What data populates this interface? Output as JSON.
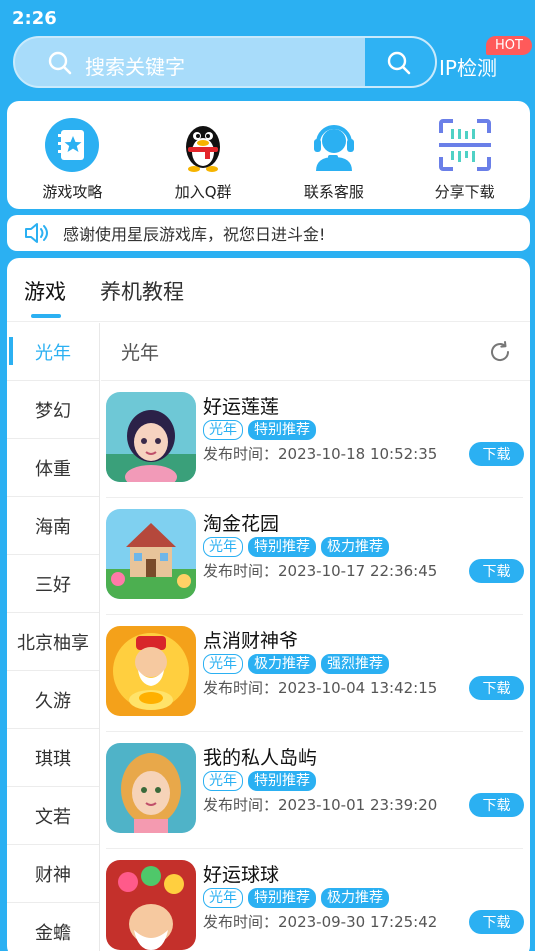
{
  "status_bar": {
    "time": "2:26"
  },
  "search": {
    "placeholder": "搜索关键字"
  },
  "ip_check": {
    "label": "IP检测",
    "badge": "HOT"
  },
  "quick_links": [
    {
      "label": "游戏攻略",
      "icon": "book-star-icon"
    },
    {
      "label": "加入Q群",
      "icon": "qq-penguin-icon"
    },
    {
      "label": "联系客服",
      "icon": "headset-icon"
    },
    {
      "label": "分享下载",
      "icon": "scan-code-icon"
    }
  ],
  "notice": {
    "text": "感谢使用星辰游戏库，祝您日进斗金!"
  },
  "tabs": [
    {
      "label": "游戏"
    },
    {
      "label": "养机教程"
    }
  ],
  "categories": [
    {
      "label": "光年"
    },
    {
      "label": "梦幻"
    },
    {
      "label": "体重"
    },
    {
      "label": "海南"
    },
    {
      "label": "三好"
    },
    {
      "label": "北京柚享"
    },
    {
      "label": "久游"
    },
    {
      "label": "琪琪"
    },
    {
      "label": "文若"
    },
    {
      "label": "财神"
    },
    {
      "label": "金蟾"
    }
  ],
  "current_category": {
    "title": "光年"
  },
  "games": [
    {
      "name": "好运莲莲",
      "tags": [
        "光年",
        "特别推荐"
      ],
      "date": "发布时间：2023-10-18 10:52:35",
      "button": "下载"
    },
    {
      "name": "淘金花园",
      "tags": [
        "光年",
        "特别推荐",
        "极力推荐"
      ],
      "date": "发布时间：2023-10-17 22:36:45",
      "button": "下载"
    },
    {
      "name": "点消财神爷",
      "tags": [
        "光年",
        "极力推荐",
        "强烈推荐"
      ],
      "date": "发布时间：2023-10-04 13:42:15",
      "button": "下载"
    },
    {
      "name": "我的私人岛屿",
      "tags": [
        "光年",
        "特别推荐"
      ],
      "date": "发布时间：2023-10-01 23:39:20",
      "button": "下载"
    },
    {
      "name": "好运球球",
      "tags": [
        "光年",
        "特别推荐",
        "极力推荐"
      ],
      "date": "发布时间：2023-09-30 17:25:42",
      "button": "下载"
    }
  ],
  "colors": {
    "accent": "#2bb0f2",
    "hot": "#ff5a5a"
  }
}
